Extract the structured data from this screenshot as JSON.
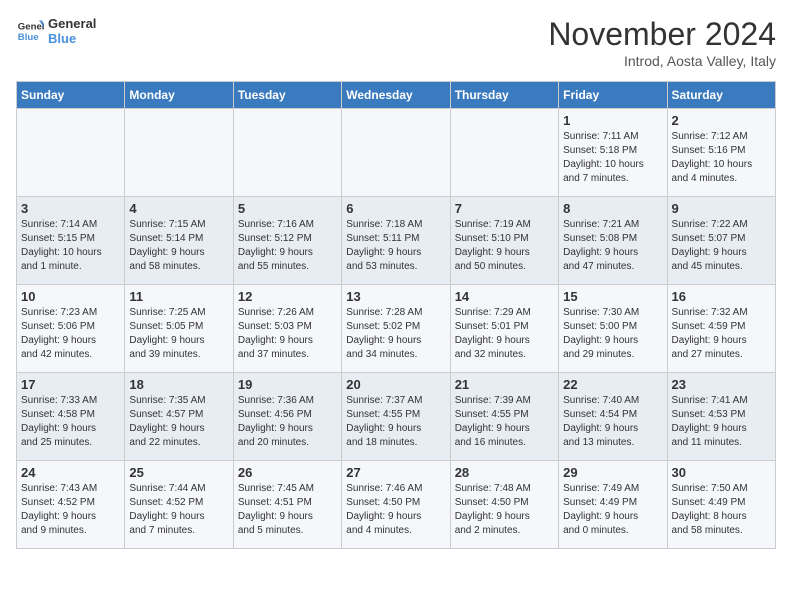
{
  "logo": {
    "line1": "General",
    "line2": "Blue"
  },
  "title": "November 2024",
  "location": "Introd, Aosta Valley, Italy",
  "weekdays": [
    "Sunday",
    "Monday",
    "Tuesday",
    "Wednesday",
    "Thursday",
    "Friday",
    "Saturday"
  ],
  "weeks": [
    [
      {
        "day": "",
        "info": ""
      },
      {
        "day": "",
        "info": ""
      },
      {
        "day": "",
        "info": ""
      },
      {
        "day": "",
        "info": ""
      },
      {
        "day": "",
        "info": ""
      },
      {
        "day": "1",
        "info": "Sunrise: 7:11 AM\nSunset: 5:18 PM\nDaylight: 10 hours\nand 7 minutes."
      },
      {
        "day": "2",
        "info": "Sunrise: 7:12 AM\nSunset: 5:16 PM\nDaylight: 10 hours\nand 4 minutes."
      }
    ],
    [
      {
        "day": "3",
        "info": "Sunrise: 7:14 AM\nSunset: 5:15 PM\nDaylight: 10 hours\nand 1 minute."
      },
      {
        "day": "4",
        "info": "Sunrise: 7:15 AM\nSunset: 5:14 PM\nDaylight: 9 hours\nand 58 minutes."
      },
      {
        "day": "5",
        "info": "Sunrise: 7:16 AM\nSunset: 5:12 PM\nDaylight: 9 hours\nand 55 minutes."
      },
      {
        "day": "6",
        "info": "Sunrise: 7:18 AM\nSunset: 5:11 PM\nDaylight: 9 hours\nand 53 minutes."
      },
      {
        "day": "7",
        "info": "Sunrise: 7:19 AM\nSunset: 5:10 PM\nDaylight: 9 hours\nand 50 minutes."
      },
      {
        "day": "8",
        "info": "Sunrise: 7:21 AM\nSunset: 5:08 PM\nDaylight: 9 hours\nand 47 minutes."
      },
      {
        "day": "9",
        "info": "Sunrise: 7:22 AM\nSunset: 5:07 PM\nDaylight: 9 hours\nand 45 minutes."
      }
    ],
    [
      {
        "day": "10",
        "info": "Sunrise: 7:23 AM\nSunset: 5:06 PM\nDaylight: 9 hours\nand 42 minutes."
      },
      {
        "day": "11",
        "info": "Sunrise: 7:25 AM\nSunset: 5:05 PM\nDaylight: 9 hours\nand 39 minutes."
      },
      {
        "day": "12",
        "info": "Sunrise: 7:26 AM\nSunset: 5:03 PM\nDaylight: 9 hours\nand 37 minutes."
      },
      {
        "day": "13",
        "info": "Sunrise: 7:28 AM\nSunset: 5:02 PM\nDaylight: 9 hours\nand 34 minutes."
      },
      {
        "day": "14",
        "info": "Sunrise: 7:29 AM\nSunset: 5:01 PM\nDaylight: 9 hours\nand 32 minutes."
      },
      {
        "day": "15",
        "info": "Sunrise: 7:30 AM\nSunset: 5:00 PM\nDaylight: 9 hours\nand 29 minutes."
      },
      {
        "day": "16",
        "info": "Sunrise: 7:32 AM\nSunset: 4:59 PM\nDaylight: 9 hours\nand 27 minutes."
      }
    ],
    [
      {
        "day": "17",
        "info": "Sunrise: 7:33 AM\nSunset: 4:58 PM\nDaylight: 9 hours\nand 25 minutes."
      },
      {
        "day": "18",
        "info": "Sunrise: 7:35 AM\nSunset: 4:57 PM\nDaylight: 9 hours\nand 22 minutes."
      },
      {
        "day": "19",
        "info": "Sunrise: 7:36 AM\nSunset: 4:56 PM\nDaylight: 9 hours\nand 20 minutes."
      },
      {
        "day": "20",
        "info": "Sunrise: 7:37 AM\nSunset: 4:55 PM\nDaylight: 9 hours\nand 18 minutes."
      },
      {
        "day": "21",
        "info": "Sunrise: 7:39 AM\nSunset: 4:55 PM\nDaylight: 9 hours\nand 16 minutes."
      },
      {
        "day": "22",
        "info": "Sunrise: 7:40 AM\nSunset: 4:54 PM\nDaylight: 9 hours\nand 13 minutes."
      },
      {
        "day": "23",
        "info": "Sunrise: 7:41 AM\nSunset: 4:53 PM\nDaylight: 9 hours\nand 11 minutes."
      }
    ],
    [
      {
        "day": "24",
        "info": "Sunrise: 7:43 AM\nSunset: 4:52 PM\nDaylight: 9 hours\nand 9 minutes."
      },
      {
        "day": "25",
        "info": "Sunrise: 7:44 AM\nSunset: 4:52 PM\nDaylight: 9 hours\nand 7 minutes."
      },
      {
        "day": "26",
        "info": "Sunrise: 7:45 AM\nSunset: 4:51 PM\nDaylight: 9 hours\nand 5 minutes."
      },
      {
        "day": "27",
        "info": "Sunrise: 7:46 AM\nSunset: 4:50 PM\nDaylight: 9 hours\nand 4 minutes."
      },
      {
        "day": "28",
        "info": "Sunrise: 7:48 AM\nSunset: 4:50 PM\nDaylight: 9 hours\nand 2 minutes."
      },
      {
        "day": "29",
        "info": "Sunrise: 7:49 AM\nSunset: 4:49 PM\nDaylight: 9 hours\nand 0 minutes."
      },
      {
        "day": "30",
        "info": "Sunrise: 7:50 AM\nSunset: 4:49 PM\nDaylight: 8 hours\nand 58 minutes."
      }
    ]
  ]
}
